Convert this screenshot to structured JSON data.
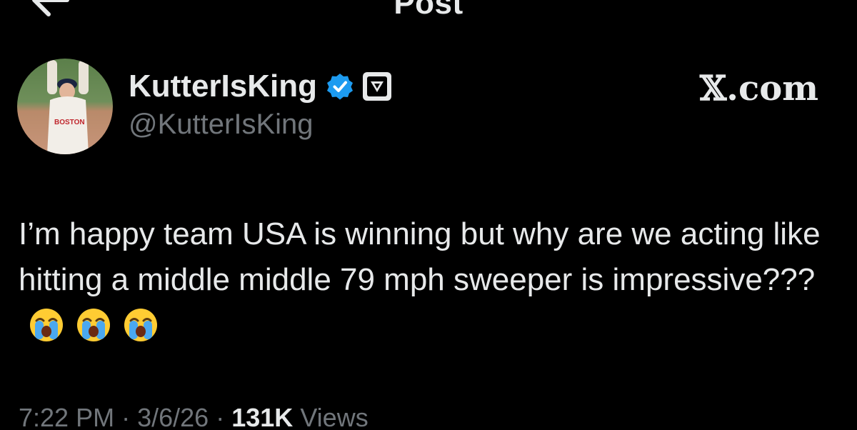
{
  "header": {
    "title": "Post",
    "back_icon": "arrow-left-icon",
    "more_icon": "more-dots-icon"
  },
  "author": {
    "display_name": "KutterIsKing",
    "handle": "@KutterIsKing",
    "verified_icon": "verified-badge-icon",
    "affiliate_icon": "affiliate-badge-icon",
    "avatar_shirt_text": "BOSTON"
  },
  "watermark": "𝕏.com",
  "tweet": {
    "text": "I’m happy team USA is winning but why are we acting like hitting a middle middle 79 mph sweeper is impressive???",
    "emojis": [
      "😭",
      "😭",
      "😭"
    ]
  },
  "meta": {
    "time": "7:22 PM",
    "date": "3/6/26",
    "views_count": "131K",
    "views_label": "Views",
    "separator": "·"
  },
  "colors": {
    "background": "#000000",
    "text_primary": "#e7e9ea",
    "text_secondary": "#71767b",
    "verified_blue": "#1d9bf0"
  }
}
